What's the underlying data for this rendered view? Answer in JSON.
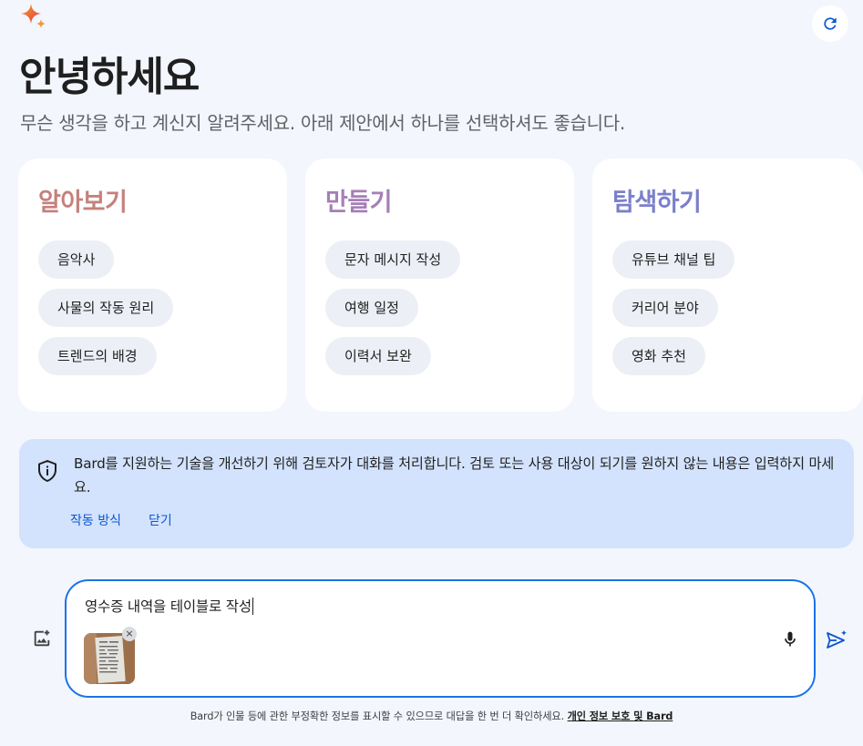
{
  "header": {
    "logo_icon": "bard-sparkle-icon",
    "refresh_icon": "refresh-icon",
    "greeting": "안녕하세요",
    "subtitle": "무슨 생각을 하고 계신지 알려주세요. 아래 제안에서 하나를 선택하셔도 좋습니다."
  },
  "cards": [
    {
      "title": "알아보기",
      "color": "#c5817c",
      "chips": [
        "음악사",
        "사물의 작동 원리",
        "트렌드의 배경"
      ]
    },
    {
      "title": "만들기",
      "color": "#a57fb6",
      "chips": [
        "문자 메시지 작성",
        "여행 일정",
        "이력서 보완"
      ]
    },
    {
      "title": "탐색하기",
      "color": "#7b7fcb",
      "chips": [
        "유튜브 채널 팁",
        "커리어 분야",
        "영화 추천"
      ]
    }
  ],
  "notice": {
    "icon": "shield-info-icon",
    "text": "Bard를 지원하는 기술을 개선하기 위해 검토자가 대화를 처리합니다. 검토 또는 사용 대상이 되기를 원하지 않는 내용은 입력하지 마세요.",
    "how_it_works": "작동 방식",
    "dismiss": "닫기"
  },
  "prompt": {
    "text": "영수증 내역을 테이블로 작성",
    "attachment_remove": "×",
    "add_image_icon": "add-image-icon",
    "mic_icon": "microphone-icon",
    "send_icon": "send-icon"
  },
  "footer": {
    "disclaimer": "Bard가 인물 등에 관한 부정확한 정보를 표시할 수 있으므로 대답을 한 번 더 확인하세요.",
    "link": "개인 정보 보호 및 Bard"
  },
  "colors": {
    "background": "#f3f6fc",
    "card": "#ffffff",
    "chip": "#eceff6",
    "notice_bg": "#d3e3fd",
    "link": "#0b57d0",
    "focus_border": "#1a73e8"
  }
}
